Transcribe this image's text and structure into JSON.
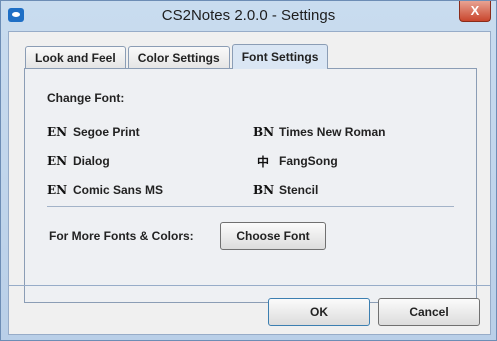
{
  "window": {
    "title": "CS2Notes 2.0.0 - Settings",
    "close_glyph": "X"
  },
  "tabs": [
    {
      "label": "Look and Feel"
    },
    {
      "label": "Color Settings"
    },
    {
      "label": "Font Settings"
    }
  ],
  "panel": {
    "heading": "Change Font:",
    "fonts": [
      {
        "icon": "EN",
        "label": "Segoe Print"
      },
      {
        "icon": "EN",
        "label": "Dialog"
      },
      {
        "icon": "EN",
        "label": "Comic Sans MS"
      },
      {
        "icon": "BN",
        "label": "Times New Roman"
      },
      {
        "icon": "中",
        "label": "FangSong"
      },
      {
        "icon": "BN",
        "label": "Stencil"
      }
    ],
    "more_label": "For More Fonts & Colors:",
    "choose_button": "Choose Font"
  },
  "footer": {
    "ok_label": "OK",
    "cancel_label": "Cancel"
  }
}
